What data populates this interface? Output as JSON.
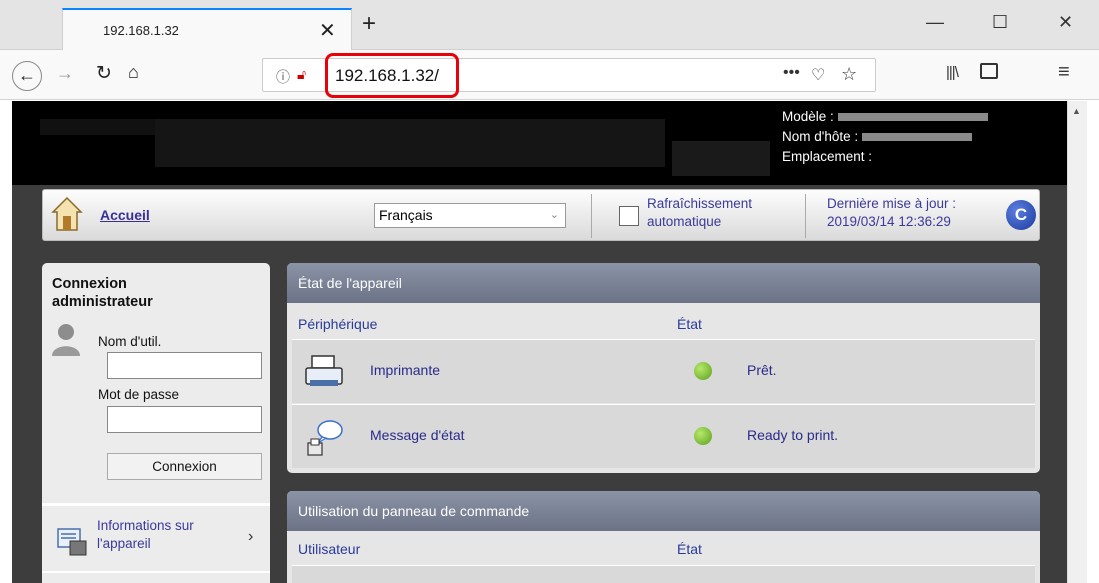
{
  "browser": {
    "tab_title": "192.168.1.32",
    "url": "192.168.1.32/"
  },
  "header": {
    "model_label": "Modèle :",
    "hostname_label": "Nom d'hôte :",
    "location_label": "Emplacement :"
  },
  "navstrip": {
    "home_label": "Accueil",
    "language": "Français",
    "auto_refresh_line1": "Rafraîchissement",
    "auto_refresh_line2": "automatique",
    "last_update_line1": "Dernière mise à jour :",
    "last_update_line2": "2019/03/14 12:36:29",
    "refresh_glyph": "C"
  },
  "login": {
    "title_line1": "Connexion",
    "title_line2": "administrateur",
    "username_label": "Nom d'util.",
    "username_value": "",
    "password_label": "Mot de passe",
    "password_value": "",
    "login_button": "Connexion",
    "device_info_line1": "Informations sur",
    "device_info_line2": "l'appareil"
  },
  "device_status": {
    "title": "État de l'appareil",
    "col_device": "Périphérique",
    "col_state": "État",
    "rows": [
      {
        "device": "Imprimante",
        "state": "Prêt.",
        "status_color": "#6cc02a"
      },
      {
        "device": "Message d'état",
        "state": "Ready to print.",
        "status_color": "#6cc02a"
      }
    ]
  },
  "panel_usage": {
    "title": "Utilisation du panneau de commande",
    "col_user": "Utilisateur",
    "col_state": "État"
  },
  "colors": {
    "url_highlight": "#e8000b",
    "link": "#3a2f9a",
    "panel_header": "#7a8194"
  }
}
